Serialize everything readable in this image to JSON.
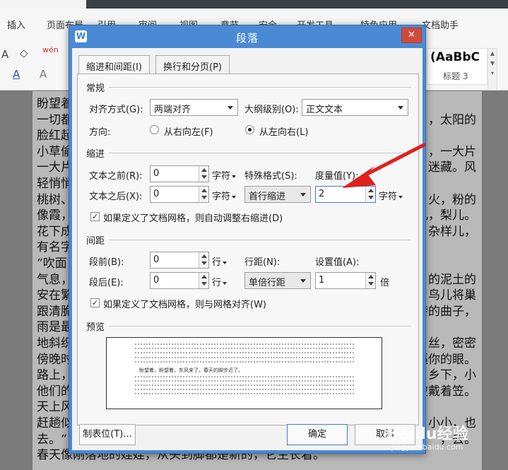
{
  "ribbon": {
    "tabs": [
      "插入",
      "页面布局",
      "引用",
      "审阅",
      "视图",
      "章节",
      "安全",
      "开发工具",
      "特色应用",
      "文档助手"
    ],
    "style_sample": "AaBbC",
    "style_sample_prefix": "(",
    "style_name": "标题 3",
    "tools": {
      "font_size_a": "A",
      "eraser": "◇",
      "pinyin": "wén",
      "font_color": "A",
      "char_shade": "A"
    }
  },
  "document": {
    "left_lines": [
      "盼望着",
      "一切都",
      "脸红起",
      "小草偷",
      "一大片",
      "轻悄悄",
      "桃树、",
      "像霞，",
      "花下成",
      "有名字",
      "“吹面",
      "气息，",
      "安在繁",
      "跟清脆",
      "雨是最",
      "地斜织",
      "傍晚时",
      "路上，",
      "他们的",
      "天上风",
      "赶趟似",
      "去。“",
      "春天像刚落地的娃娃，从头到脚都是新的，它生长着。"
    ],
    "right_lines": [
      {
        "row": 1,
        "text": "，太阳的"
      },
      {
        "row": 3,
        "text": "，一大片"
      },
      {
        "row": 4,
        "text": "迷藏。风"
      },
      {
        "row": 6,
        "text": "火，粉的"
      },
      {
        "row": 7,
        "text": "儿，梨儿。"
      },
      {
        "row": 8,
        "text": "杂样儿，"
      },
      {
        "row": 11,
        "text": "的泥土的"
      },
      {
        "row": 12,
        "text": "鸟儿将巢"
      },
      {
        "row": 13,
        "text": "转的曲子，"
      },
      {
        "row": 15,
        "text": "丝，密密"
      },
      {
        "row": 16,
        "text": "逼你的眼。"
      },
      {
        "row": 17,
        "text": "乡下，小"
      },
      {
        "row": 18,
        "text": "披戴着笠。"
      },
      {
        "row": 20,
        "text": "小小，也"
      },
      {
        "row": 21,
        "text": "，去。"
      }
    ]
  },
  "dialog": {
    "title": "段落",
    "app_icon": "W",
    "close_symbol": "✕",
    "tabs": [
      "缩进和间距(I)",
      "换行和分页(P)"
    ],
    "general": {
      "heading": "常规",
      "alignment_label": "对齐方式(G):",
      "alignment_value": "两端对齐",
      "outline_label": "大纲级别(O):",
      "outline_value": "正文文本",
      "direction_label": "方向:",
      "rtl_label": "从右向左(F)",
      "ltr_label": "从左向右(L)",
      "rtl_checked": false,
      "ltr_checked": true
    },
    "indent": {
      "heading": "缩进",
      "before_label": "文本之前(R):",
      "before_value": "0",
      "before_unit": "字符",
      "after_label": "文本之后(X):",
      "after_value": "0",
      "after_unit": "字符",
      "special_label": "特殊格式(S):",
      "special_value": "首行缩进",
      "measure_label": "度量值(Y):",
      "measure_value": "2",
      "measure_unit": "字符",
      "grid_checkbox_label": "如果定义了文档网格，则自动调整右缩进(D)",
      "grid_checked": true
    },
    "spacing": {
      "heading": "间距",
      "before_label": "段前(B):",
      "before_value": "0",
      "before_unit": "行",
      "after_label": "段后(E):",
      "after_value": "0",
      "after_unit": "行",
      "line_label": "行距(N):",
      "line_value": "单倍行距",
      "setting_label": "设置值(A):",
      "setting_value": "1",
      "setting_unit": "倍",
      "grid_checkbox_label": "如果定义了文档网格，则与网格对齐(W)",
      "grid_checked": true
    },
    "preview": {
      "heading": "预览",
      "sample_text": "盼望着，盼望着，东风来了，春天的脚步近了。"
    },
    "buttons": {
      "tabs": "制表位(T)...",
      "ok": "确定",
      "cancel": "取消"
    }
  },
  "watermark": {
    "main": "Baidu经验",
    "sub": "jingyan.baidu.com"
  },
  "colors": {
    "dialog_title_bar": "#4a8ad4",
    "close_button": "#cf4c3c",
    "annotation_arrow": "#e0201e",
    "document_highlight": "#b9b9b9"
  }
}
